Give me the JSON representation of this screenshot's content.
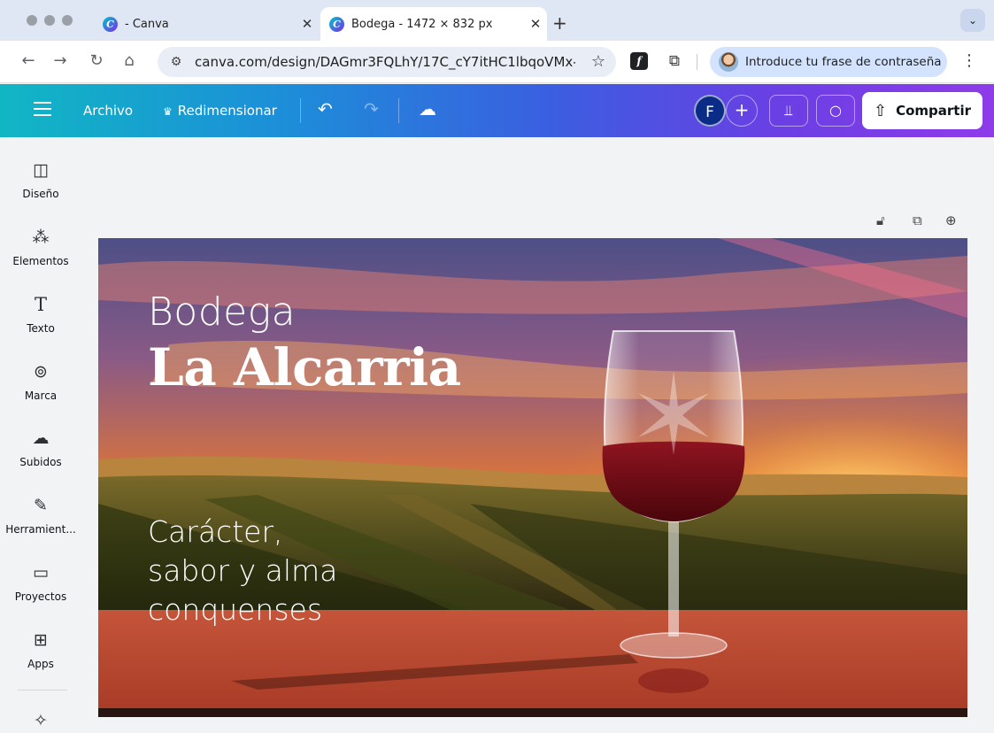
{
  "browser": {
    "tabs": [
      {
        "title": " - Canva",
        "close": "✕",
        "active": false
      },
      {
        "title": "Bodega - 1472 × 832 px",
        "close": "✕",
        "active": true
      }
    ],
    "new_tab": "+",
    "tab_menu": "⌄",
    "nav": {
      "back": "←",
      "forward": "→",
      "reload": "↻",
      "home": "⌂"
    },
    "url": "canva.com/design/DAGmr3FQLhY/17C_cY7itHC1lbqoVMx-...",
    "bookmark": "☆",
    "extension_f": "f",
    "extension_puzzle": "⧉",
    "profile_prompt": "Introduce tu frase de contraseña",
    "menu": "⋮"
  },
  "canva_header": {
    "archivo": "Archivo",
    "redimensionar": "Redimensionar",
    "redimensionar_icon": "♛",
    "undo": "↶",
    "redo": "↷",
    "cloud": "☁",
    "avatar_initial": "F",
    "add": "+",
    "insights": "⫫",
    "comment": "○",
    "share_icon": "⇧",
    "share": "Compartir"
  },
  "sidebar": {
    "items": [
      {
        "label": "Diseño",
        "icon": "◫"
      },
      {
        "label": "Elementos",
        "icon": "⁂"
      },
      {
        "label": "Texto",
        "icon": "T"
      },
      {
        "label": "Marca",
        "icon": "⊚"
      },
      {
        "label": "Subidos",
        "icon": "☁"
      },
      {
        "label": "Herramient...",
        "icon": "✎"
      },
      {
        "label": "Proyectos",
        "icon": "▭"
      },
      {
        "label": "Apps",
        "icon": "⊞"
      },
      {
        "label": "",
        "icon": "✧"
      }
    ]
  },
  "canvas_tools": {
    "lock": "🔓︎",
    "duplicate": "⧉",
    "add_page": "⊕"
  },
  "design": {
    "line1": "Bodega",
    "line2": "La Alcarria",
    "tagline": [
      "Carácter,",
      "sabor y alma",
      "conquenses"
    ]
  },
  "colors": {
    "header_start": "#11b6c4",
    "header_end": "#8e3be8",
    "sky_top": "#5a4a7a",
    "sunset": "#f08a2a",
    "wine": "#6e0a12",
    "table": "#b8442e"
  }
}
